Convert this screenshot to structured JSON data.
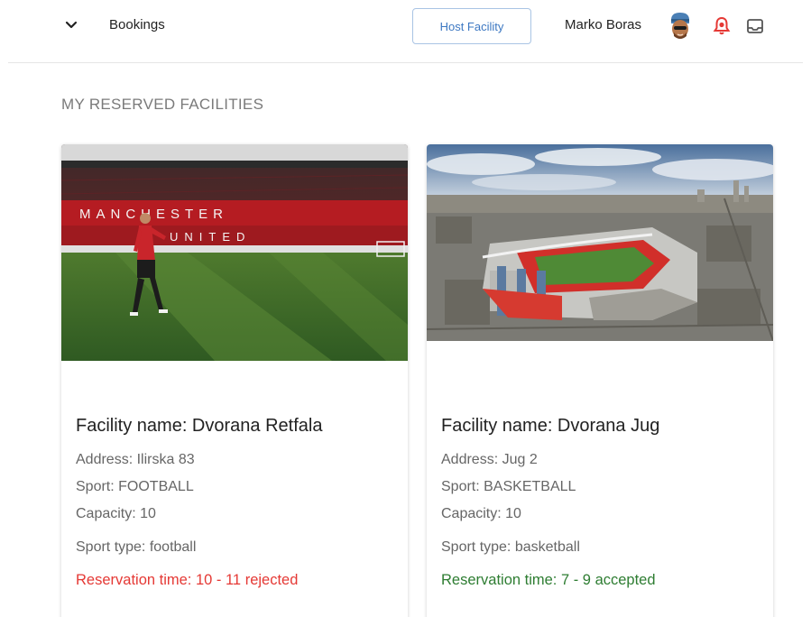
{
  "header": {
    "nav_label": "Bookings",
    "host_button": "Host Facility",
    "user_name": "Marko Boras",
    "icons": [
      "chevron-down-icon",
      "avatar",
      "bell-icon",
      "inbox-icon"
    ],
    "bell_color": "#e53935"
  },
  "main": {
    "section_title": "MY RESERVED FACILITIES",
    "facilities": [
      {
        "name": "Facility name: Dvorana Retfala",
        "address": "Address: Ilirska 83",
        "sport": "Sport: FOOTBALL",
        "capacity": "Capacity: 10",
        "sport_type": "Sport type: football",
        "reservation": "Reservation time: 10 - 11 rejected",
        "status_color": "#e53935"
      },
      {
        "name": "Facility name: Dvorana Jug",
        "address": "Address: Jug 2",
        "sport": "Sport: BASKETBALL",
        "capacity": "Capacity: 10",
        "sport_type": "Sport type: basketball",
        "reservation": "Reservation time: 7 - 9 accepted",
        "status_color": "#2e7d32"
      }
    ]
  }
}
